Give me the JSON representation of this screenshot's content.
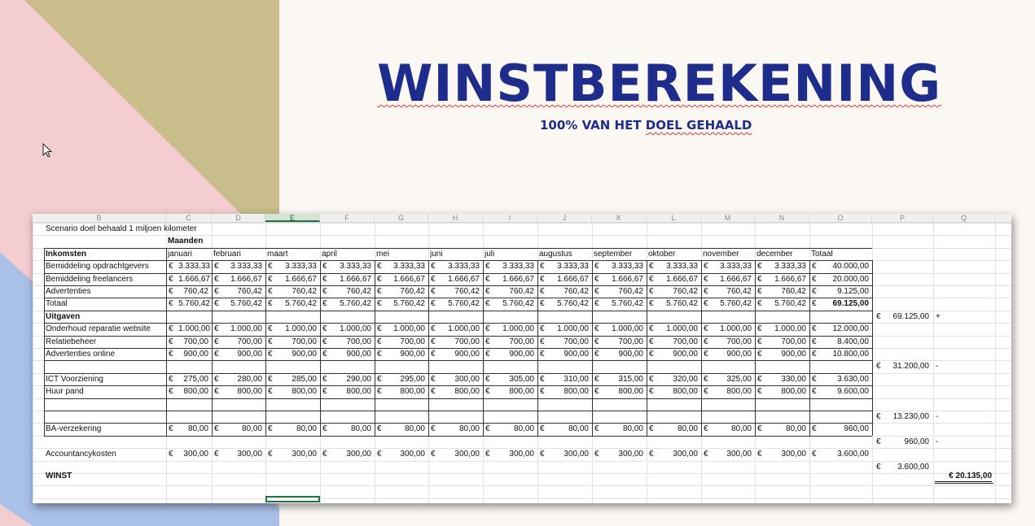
{
  "slide": {
    "title": "WINSTBEREKENING",
    "subtitle_pre": "100% VAN HET ",
    "subtitle_err": "DOEL GEHAALD"
  },
  "colors": {
    "title": "#1e2d8c",
    "triangle_gold": "#c9bd8c",
    "triangle_pink": "#f3cdd0",
    "triangle_blue": "#a9c1e6"
  },
  "sheet": {
    "column_letters": [
      "B",
      "C",
      "D",
      "E",
      "F",
      "G",
      "H",
      "I",
      "J",
      "K",
      "L",
      "M",
      "N",
      "O",
      "P",
      "Q"
    ],
    "selected_column": "E",
    "scenario": "Scenario doel behaald 1 miljoen kilometer",
    "maanden": "Maanden",
    "inkomsten": "Inkomsten",
    "months": [
      "januari",
      "februari",
      "maart",
      "april",
      "mei",
      "juni",
      "juli",
      "augustus",
      "september",
      "oktober",
      "november",
      "december",
      "Totaal"
    ],
    "currency": "€",
    "rows": [
      {
        "label": "Bemiddeling opdrachtgevers",
        "values": [
          "3.333,33",
          "3.333,33",
          "3.333,33",
          "3.333,33",
          "3.333,33",
          "3.333,33",
          "3.333,33",
          "3.333,33",
          "3.333,33",
          "3.333,33",
          "3.333,33",
          "3.333,33",
          "40.000,00"
        ]
      },
      {
        "label": "Bemiddeling freelancers",
        "values": [
          "1.666,67",
          "1.666,67",
          "1.666,67",
          "1.666,67",
          "1.666,67",
          "1.666,67",
          "1.666,67",
          "1.666,67",
          "1.666,67",
          "1.666,67",
          "1.666,67",
          "1.666,67",
          "20.000,00"
        ]
      },
      {
        "label": "Advertenties",
        "values": [
          "760,42",
          "760,42",
          "760,42",
          "760,42",
          "760,42",
          "760,42",
          "760,42",
          "760,42",
          "760,42",
          "760,42",
          "760,42",
          "760,42",
          "9.125,00"
        ]
      },
      {
        "label": "Totaal",
        "values": [
          "5.760,42",
          "5.760,42",
          "5.760,42",
          "5.760,42",
          "5.760,42",
          "5.760,42",
          "5.760,42",
          "5.760,42",
          "5.760,42",
          "5.760,42",
          "5.760,42",
          "5.760,42",
          "69.125,00"
        ]
      },
      {
        "label": "Uitgaven",
        "values": []
      },
      {
        "label": "Onderhoud reparatie website",
        "values": [
          "1.000,00",
          "1.000,00",
          "1.000,00",
          "1.000,00",
          "1.000,00",
          "1.000,00",
          "1.000,00",
          "1.000,00",
          "1.000,00",
          "1.000,00",
          "1.000,00",
          "1.000,00",
          "12.000,00"
        ]
      },
      {
        "label": "Relatiebeheer",
        "values": [
          "700,00",
          "700,00",
          "700,00",
          "700,00",
          "700,00",
          "700,00",
          "700,00",
          "700,00",
          "700,00",
          "700,00",
          "700,00",
          "700,00",
          "8.400,00"
        ]
      },
      {
        "label": "Advertenties online",
        "values": [
          "900,00",
          "900,00",
          "900,00",
          "900,00",
          "900,00",
          "900,00",
          "900,00",
          "900,00",
          "900,00",
          "900,00",
          "900,00",
          "900,00",
          "10.800,00"
        ]
      },
      {
        "label": "",
        "values": []
      },
      {
        "label": "ICT Voorziening",
        "values": [
          "275,00",
          "280,00",
          "285,00",
          "290,00",
          "295,00",
          "300,00",
          "305,00",
          "310,00",
          "315,00",
          "320,00",
          "325,00",
          "330,00",
          "3.630,00"
        ]
      },
      {
        "label": "Huur pand",
        "values": [
          "800,00",
          "800,00",
          "800,00",
          "800,00",
          "800,00",
          "800,00",
          "800,00",
          "800,00",
          "800,00",
          "800,00",
          "800,00",
          "800,00",
          "9.600,00"
        ]
      },
      {
        "label": "",
        "values": []
      },
      {
        "label": "",
        "values": []
      },
      {
        "label": "BA-verzekering",
        "values": [
          "80,00",
          "80,00",
          "80,00",
          "80,00",
          "80,00",
          "80,00",
          "80,00",
          "80,00",
          "80,00",
          "80,00",
          "80,00",
          "80,00",
          "960,00"
        ]
      },
      {
        "label": "",
        "values": []
      },
      {
        "label": "Accountancykosten",
        "values": [
          "300,00",
          "300,00",
          "300,00",
          "300,00",
          "300,00",
          "300,00",
          "300,00",
          "300,00",
          "300,00",
          "300,00",
          "300,00",
          "300,00",
          "3.600,00"
        ]
      },
      {
        "label": "",
        "values": []
      }
    ],
    "p_column": [
      {
        "row": 4,
        "value": "69.125,00",
        "sign": "+"
      },
      {
        "row": 8,
        "value": "31.200,00",
        "sign": "-"
      },
      {
        "row": 12,
        "value": "13.230,00",
        "sign": "-"
      },
      {
        "row": 14,
        "value": "960,00",
        "sign": "-"
      },
      {
        "row": 16,
        "value": "3.600,00",
        "sign": ""
      }
    ],
    "winst_label": "WINST",
    "winst_value": "€   20.135,00"
  }
}
